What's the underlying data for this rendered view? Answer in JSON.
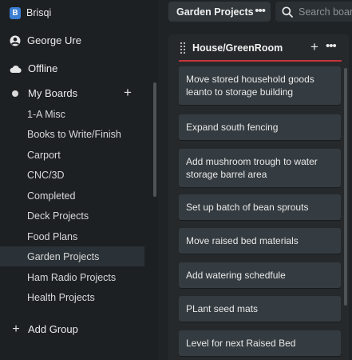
{
  "app": {
    "name": "Brisqi",
    "logo_letter": "B"
  },
  "sidebar": {
    "user": {
      "name": "George Ure",
      "icon": "user-icon"
    },
    "status": {
      "label": "Offline",
      "icon": "cloud-icon"
    },
    "boards_section": {
      "label": "My Boards",
      "add_icon": "+"
    },
    "boards": [
      {
        "label": "1-A Misc",
        "active": false
      },
      {
        "label": "Books to Write/Finish",
        "active": false
      },
      {
        "label": "Carport",
        "active": false
      },
      {
        "label": "CNC/3D",
        "active": false
      },
      {
        "label": "Completed",
        "active": false
      },
      {
        "label": "Deck Projects",
        "active": false
      },
      {
        "label": "Food Plans",
        "active": false
      },
      {
        "label": "Garden Projects",
        "active": true
      },
      {
        "label": "Ham Radio Projects",
        "active": false
      },
      {
        "label": "Health Projects",
        "active": false
      }
    ],
    "add_group": {
      "label": "Add Group",
      "icon": "+"
    }
  },
  "topbar": {
    "board_title": "Garden Projects",
    "more_icon": "•••",
    "search": {
      "placeholder": "Search boards"
    }
  },
  "list": {
    "title": "House/GreenRoom",
    "add_icon": "+",
    "more_icon": "•••",
    "accent_color": "#c8323a",
    "cards": [
      "Move stored household goods leanto to storage building",
      "Expand south fencing",
      "Add mushroom trough to water storage barrel area",
      "Set up batch of bean sprouts",
      "Move raised bed materials",
      "Add watering schedfule",
      "PLant seed mats",
      "Level for next Raised Bed"
    ]
  }
}
